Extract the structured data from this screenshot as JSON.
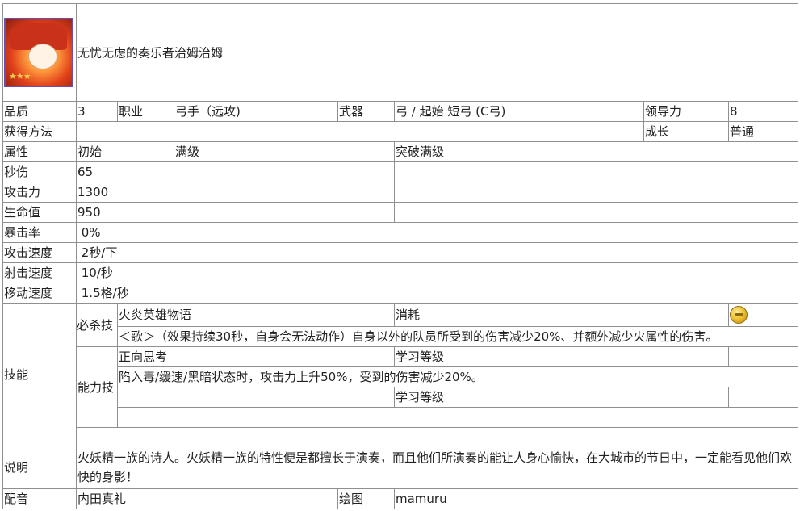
{
  "header": {
    "name": "无忧无虑的奏乐者治姆治姆",
    "stars": "★★★"
  },
  "row_quality": {
    "quality_label": "品质",
    "quality_value": "3",
    "class_label": "职业",
    "class_value": "弓手（远攻)",
    "weapon_label": "武器",
    "weapon_value": "弓 / 起始 短弓 (C弓)",
    "leadership_label": "领导力",
    "leadership_value": "8"
  },
  "row_obtain": {
    "obtain_label": "获得方法",
    "obtain_value": "",
    "growth_label": "成长",
    "growth_value": "普通"
  },
  "stats_header": {
    "attr_label": "属性",
    "initial_label": "初始",
    "max_label": "满级",
    "break_label": "突破满级"
  },
  "stats": [
    {
      "label": "秒伤",
      "initial": "65",
      "max": "",
      "break": ""
    },
    {
      "label": "攻击力",
      "initial": "1300",
      "max": "",
      "break": ""
    },
    {
      "label": "生命值",
      "initial": "950",
      "max": "",
      "break": ""
    }
  ],
  "simple_stats": [
    {
      "label": "暴击率",
      "value": " 0%"
    },
    {
      "label": "攻击速度",
      "value": " 2秒/下"
    },
    {
      "label": "射击速度",
      "value": " 10/秒"
    },
    {
      "label": "移动速度",
      "value": " 1.5格/秒"
    }
  ],
  "skills": {
    "section_label": "技能",
    "ultimate": {
      "label": "必杀技",
      "name": "火炎英雄物语",
      "cost_label": "消耗",
      "description": "＜歌＞（效果持续30秒，自身会无法动作）自身以外的队员所受到的伤害减少20%、并额外减少火属性的伤害。"
    },
    "ability": {
      "label": "能力技",
      "name": "正向思考",
      "learn_label": "学习等级",
      "description": "陷入毒/缓速/黑暗状态时，攻击力上升50%，受到的伤害减少20%。",
      "learn_label_2": "学习等级"
    }
  },
  "description": {
    "label": "说明",
    "text": " 火妖精一族的诗人。火妖精一族的特性便是都擅长于演奏，而且他们所演奏的能让人身心愉快，在大城市的节日中，一定能看见他们欢快的身影！"
  },
  "footer": {
    "voice_label": "配音",
    "voice_value": "内田真礼",
    "art_label": "绘图",
    "art_value": "mamuru"
  }
}
